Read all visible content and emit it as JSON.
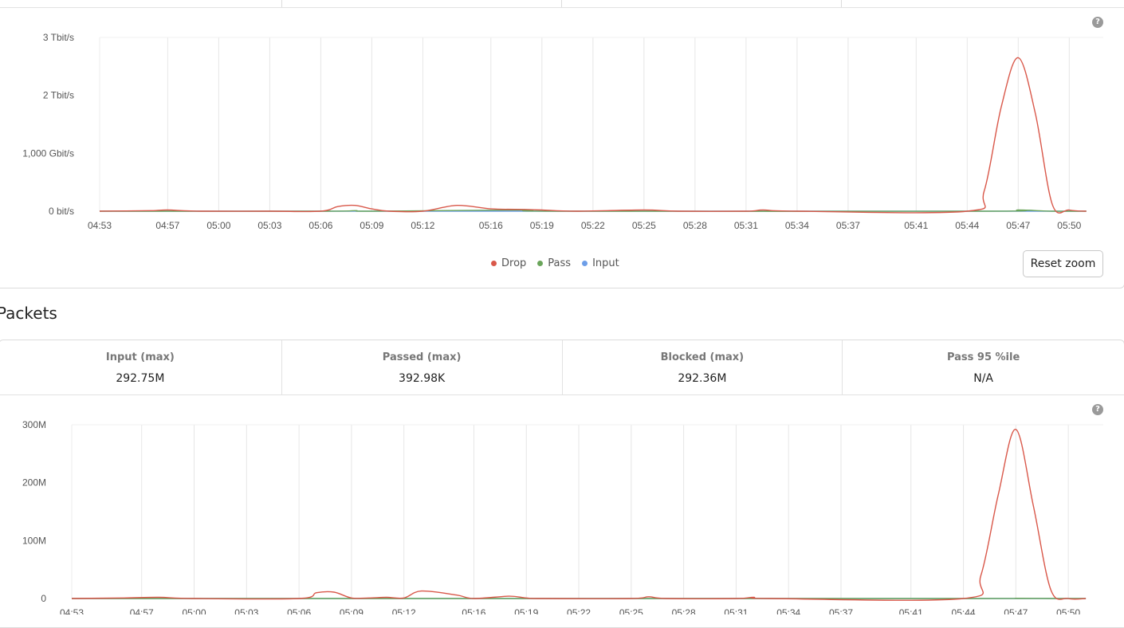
{
  "bandwidth_chart": {
    "help_icon": "question-circle-icon",
    "legend": [
      {
        "name": "Drop",
        "color": "#d9584a"
      },
      {
        "name": "Pass",
        "color": "#6aa55b"
      },
      {
        "name": "Input",
        "color": "#6d9ee8"
      }
    ],
    "reset_zoom_label": "Reset zoom"
  },
  "packets_section": {
    "title": "Packets",
    "help_icon": "question-circle-icon",
    "stats": [
      {
        "label": "Input (max)",
        "value": "292.75M"
      },
      {
        "label": "Passed (max)",
        "value": "392.98K"
      },
      {
        "label": "Blocked (max)",
        "value": "292.36M"
      },
      {
        "label": "Pass 95 %ile",
        "value": "N/A"
      }
    ]
  },
  "chart_data": [
    {
      "type": "line",
      "ylabel": "",
      "xlabel": "",
      "y_ticks": [
        "0 bit/s",
        "1,000 Gbit/s",
        "2 Tbit/s",
        "3 Tbit/s"
      ],
      "ylim_tbps": [
        0,
        3
      ],
      "x_ticks": [
        "04:53",
        "04:57",
        "05:00",
        "05:03",
        "05:06",
        "05:09",
        "05:12",
        "05:16",
        "05:19",
        "05:22",
        "05:25",
        "05:28",
        "05:31",
        "05:34",
        "05:37",
        "05:41",
        "05:44",
        "05:47",
        "05:50"
      ],
      "grid": true,
      "legend_position": "bottom",
      "series": [
        {
          "name": "Drop",
          "color": "#d9584a",
          "unit": "Tbit/s",
          "points": [
            [
              "04:53",
              0.0
            ],
            [
              "04:56",
              0.01
            ],
            [
              "04:57",
              0.02
            ],
            [
              "04:59",
              0.0
            ],
            [
              "05:03",
              0.0
            ],
            [
              "05:06",
              0.0
            ],
            [
              "05:07",
              0.08
            ],
            [
              "05:08",
              0.1
            ],
            [
              "05:09",
              0.04
            ],
            [
              "05:10",
              0.0
            ],
            [
              "05:12",
              0.0
            ],
            [
              "05:14",
              0.1
            ],
            [
              "05:16",
              0.04
            ],
            [
              "05:18",
              0.03
            ],
            [
              "05:19",
              0.02
            ],
            [
              "05:21",
              0.0
            ],
            [
              "05:25",
              0.02
            ],
            [
              "05:27",
              0.0
            ],
            [
              "05:31",
              0.0
            ],
            [
              "05:32",
              0.02
            ],
            [
              "05:34",
              0.0
            ],
            [
              "05:44",
              0.0
            ],
            [
              "05:45",
              0.35
            ],
            [
              "05:46",
              1.8
            ],
            [
              "05:47",
              2.65
            ],
            [
              "05:48",
              1.7
            ],
            [
              "05:49",
              0.12
            ],
            [
              "05:50",
              0.02
            ],
            [
              "05:51",
              0.0
            ]
          ]
        },
        {
          "name": "Pass",
          "color": "#6aa55b",
          "unit": "Tbit/s",
          "points": [
            [
              "04:53",
              0.0
            ],
            [
              "05:06",
              0.0
            ],
            [
              "05:08",
              0.01
            ],
            [
              "05:09",
              0.0
            ],
            [
              "05:18",
              0.02
            ],
            [
              "05:20",
              0.0
            ],
            [
              "05:45",
              0.0
            ],
            [
              "05:47",
              0.02
            ],
            [
              "05:49",
              0.0
            ],
            [
              "05:51",
              0.0
            ]
          ]
        },
        {
          "name": "Input",
          "color": "#6d9ee8",
          "unit": "Tbit/s",
          "points": [
            [
              "04:53",
              0.0
            ],
            [
              "05:51",
              0.0
            ]
          ]
        }
      ]
    },
    {
      "type": "line",
      "ylabel": "",
      "xlabel": "",
      "y_ticks": [
        "0",
        "100M",
        "200M",
        "300M"
      ],
      "ylim_millions": [
        0,
        300
      ],
      "x_ticks": [
        "04:53",
        "04:57",
        "05:00",
        "05:03",
        "05:06",
        "05:09",
        "05:12",
        "05:16",
        "05:19",
        "05:22",
        "05:25",
        "05:28",
        "05:31",
        "05:34",
        "05:37",
        "05:41",
        "05:44",
        "05:47",
        "05:50"
      ],
      "grid": true,
      "series": [
        {
          "name": "Drop",
          "color": "#d9584a",
          "unit": "M",
          "points": [
            [
              "04:53",
              0
            ],
            [
              "04:56",
              1
            ],
            [
              "04:58",
              2
            ],
            [
              "05:00",
              0
            ],
            [
              "05:06",
              0
            ],
            [
              "05:07",
              10
            ],
            [
              "05:08",
              11
            ],
            [
              "05:09",
              1
            ],
            [
              "05:10",
              1
            ],
            [
              "05:11",
              2
            ],
            [
              "05:12",
              1
            ],
            [
              "05:13",
              13
            ],
            [
              "05:15",
              6
            ],
            [
              "05:16",
              0
            ],
            [
              "05:18",
              4
            ],
            [
              "05:19",
              1
            ],
            [
              "05:20",
              0
            ],
            [
              "05:25",
              0
            ],
            [
              "05:26",
              3
            ],
            [
              "05:27",
              0
            ],
            [
              "05:31",
              0
            ],
            [
              "05:32",
              2
            ],
            [
              "05:33",
              0
            ],
            [
              "05:44",
              0
            ],
            [
              "05:45",
              40
            ],
            [
              "05:46",
              180
            ],
            [
              "05:47",
              292
            ],
            [
              "05:48",
              160
            ],
            [
              "05:49",
              15
            ],
            [
              "05:50",
              0
            ],
            [
              "05:51",
              0
            ]
          ]
        },
        {
          "name": "Pass",
          "color": "#6aa55b",
          "unit": "M",
          "points": [
            [
              "04:53",
              0
            ],
            [
              "05:45",
              0
            ],
            [
              "05:47",
              0.4
            ],
            [
              "05:49",
              0
            ],
            [
              "05:51",
              0
            ]
          ]
        },
        {
          "name": "Input",
          "color": "#6d9ee8",
          "unit": "M",
          "points": [
            [
              "04:53",
              0
            ],
            [
              "05:51",
              0
            ]
          ]
        }
      ]
    }
  ]
}
